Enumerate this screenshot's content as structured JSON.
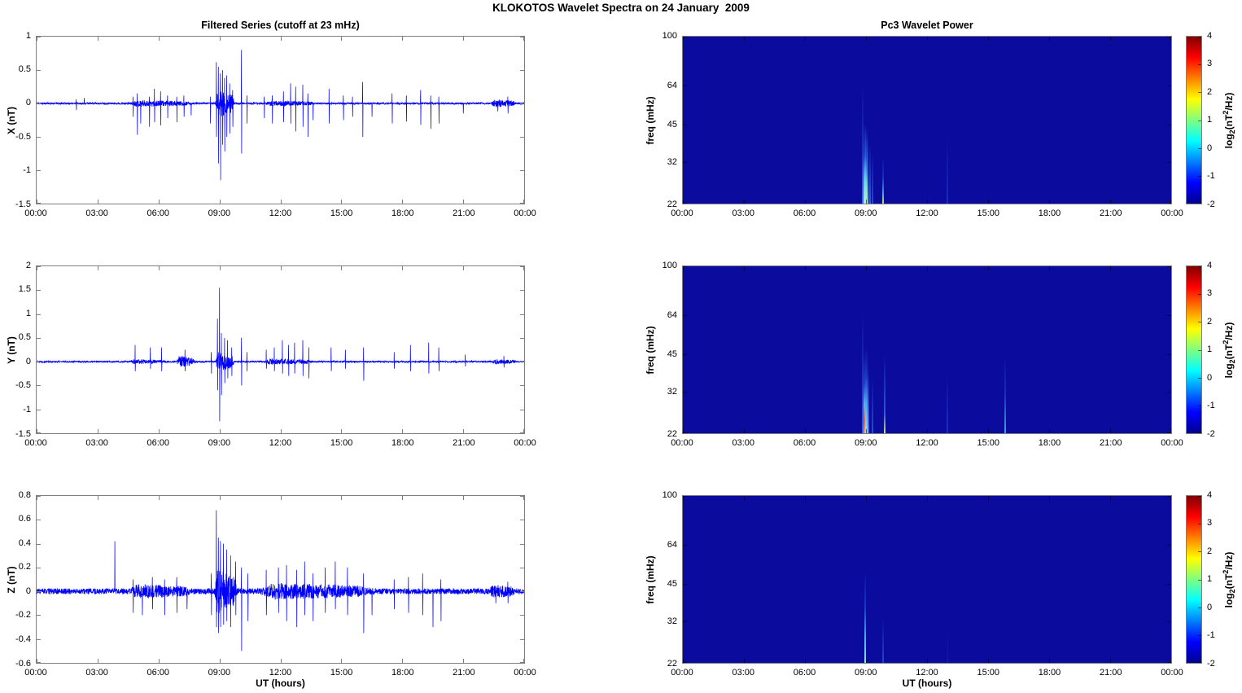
{
  "figure_title": "KLOKOTOS Wavelet Spectra on 24 January  2009",
  "left_column": {
    "title": "Filtered Series (cutoff at 23 mHz)",
    "xlabel": "UT (hours)"
  },
  "right_column": {
    "title": "Pc3 Wavelet Power",
    "xlabel": "UT (hours)"
  },
  "time_axis": {
    "tick_labels": [
      "00:00",
      "03:00",
      "06:00",
      "09:00",
      "12:00",
      "15:00",
      "18:00",
      "21:00",
      "00:00"
    ],
    "tick_hours": [
      0,
      3,
      6,
      9,
      12,
      15,
      18,
      21,
      24
    ],
    "range_hours": [
      0,
      24
    ]
  },
  "colorbar": {
    "ticks": [
      4,
      3,
      2,
      1,
      0,
      -1,
      -2
    ],
    "range": [
      -2,
      4
    ],
    "label_parts": {
      "base": "log",
      "sub": "2",
      "mid": "(nT",
      "sup": "2",
      "end": "/Hz)"
    },
    "jet_stops": [
      [
        "#000090",
        0
      ],
      [
        "#0000ff",
        12.5
      ],
      [
        "#00ffff",
        37.5
      ],
      [
        "#ffff00",
        62.5
      ],
      [
        "#ff0000",
        87.5
      ],
      [
        "#800000",
        100
      ]
    ]
  },
  "colors": {
    "line": "#0000ff",
    "heat_background": "#0b0b9d",
    "axis_frame": "#7f7f7f"
  },
  "chart_data": [
    {
      "type": "line",
      "ylabel": "X (nT)",
      "ylim": [
        -1.5,
        1
      ],
      "yticks": [
        1,
        0.5,
        0,
        -0.5,
        -1,
        -1.5
      ],
      "seed": 11,
      "noise_base": 0.014,
      "bursts": [
        [
          8.8,
          9.75,
          0.22
        ],
        [
          4.6,
          7.6,
          0.04
        ],
        [
          11.3,
          13.7,
          0.03
        ],
        [
          22.4,
          23.6,
          0.055
        ]
      ],
      "spikes": [
        [
          1.95,
          0.06,
          -0.1
        ],
        [
          2.35,
          0.08,
          null
        ],
        [
          4.75,
          0.1,
          -0.2
        ],
        [
          4.95,
          0.15,
          -0.47
        ],
        [
          5.12,
          null,
          -0.3
        ],
        [
          5.55,
          0.1,
          -0.35
        ],
        [
          5.8,
          0.22,
          -0.28
        ],
        [
          6.1,
          0.18,
          -0.33
        ],
        [
          6.45,
          0.12,
          -0.22
        ],
        [
          6.9,
          0.1,
          -0.28
        ],
        [
          7.25,
          0.12,
          -0.2
        ],
        [
          7.6,
          null,
          -0.18
        ],
        [
          8.55,
          0.1,
          -0.3
        ],
        [
          8.85,
          0.62,
          -0.5
        ],
        [
          8.95,
          0.55,
          -0.9
        ],
        [
          9.05,
          0.45,
          -1.15
        ],
        [
          9.15,
          0.5,
          -0.62
        ],
        [
          9.25,
          0.38,
          -0.72
        ],
        [
          9.35,
          0.42,
          -0.5
        ],
        [
          9.5,
          0.3,
          -0.45
        ],
        [
          9.65,
          0.2,
          -0.35
        ],
        [
          10.08,
          0.8,
          -0.75
        ],
        [
          10.35,
          0.12,
          -0.3
        ],
        [
          11.2,
          0.1,
          -0.22
        ],
        [
          11.6,
          0.12,
          -0.3
        ],
        [
          12.15,
          0.18,
          -0.28
        ],
        [
          12.5,
          0.3,
          -0.3
        ],
        [
          12.75,
          0.25,
          -0.42
        ],
        [
          13.1,
          0.28,
          -0.35
        ],
        [
          13.35,
          0.15,
          -0.5
        ],
        [
          13.6,
          null,
          -0.25
        ],
        [
          14.4,
          0.22,
          -0.3
        ],
        [
          15.1,
          0.12,
          -0.25
        ],
        [
          15.55,
          0.1,
          -0.2
        ],
        [
          16.05,
          0.32,
          -0.5
        ],
        [
          16.5,
          null,
          -0.2
        ],
        [
          17.5,
          0.15,
          -0.3
        ],
        [
          18.2,
          0.12,
          -0.27
        ],
        [
          18.9,
          0.2,
          -0.32
        ],
        [
          19.4,
          0.12,
          -0.38
        ],
        [
          19.8,
          0.1,
          -0.3
        ],
        [
          21.0,
          null,
          -0.15
        ],
        [
          22.7,
          null,
          -0.12
        ],
        [
          23.2,
          0.1,
          -0.15
        ]
      ]
    },
    {
      "type": "heatmap",
      "ylabel": "freq (mHz)",
      "flim": [
        22,
        100
      ],
      "yticks": [
        100,
        64,
        45,
        32,
        22
      ],
      "streaks": [
        {
          "t": 8.83,
          "f_top": 64,
          "w": 2,
          "stops": [
            [
              "rgba(60,120,235,0.9)",
              0
            ],
            [
              "rgba(40,80,210,0.6)",
              40
            ],
            [
              "rgba(11,11,157,0)",
              100
            ]
          ]
        },
        {
          "t": 8.93,
          "f_top": 46,
          "w": 3,
          "stops": [
            [
              "#aef0e8",
              0
            ],
            [
              "#55d0f5",
              30
            ],
            [
              "rgba(30,90,220,0.7)",
              60
            ],
            [
              "rgba(11,11,157,0)",
              100
            ]
          ]
        },
        {
          "t": 9.0,
          "f_top": 44,
          "w": 3,
          "stops": [
            [
              "#d8ee8a",
              0
            ],
            [
              "#7fe0d8",
              25
            ],
            [
              "rgba(40,110,230,0.7)",
              60
            ],
            [
              "rgba(11,11,157,0)",
              100
            ]
          ]
        },
        {
          "t": 9.08,
          "f_top": 40,
          "w": 2,
          "stops": [
            [
              "#66d4f0",
              0
            ],
            [
              "rgba(40,100,225,0.7)",
              50
            ],
            [
              "rgba(11,11,157,0)",
              100
            ]
          ]
        },
        {
          "t": 9.2,
          "f_top": 38,
          "w": 2,
          "stops": [
            [
              "rgba(50,110,230,0.85)",
              0
            ],
            [
              "rgba(11,11,157,0)",
              100
            ]
          ]
        },
        {
          "t": 9.33,
          "f_top": 35,
          "w": 2,
          "stops": [
            [
              "rgba(40,90,220,0.8)",
              0
            ],
            [
              "rgba(11,11,157,0)",
              100
            ]
          ]
        },
        {
          "t": 9.85,
          "f_top": 34,
          "w": 2,
          "stops": [
            [
              "#c8e26a",
              0
            ],
            [
              "#3f9ae8",
              22
            ],
            [
              "rgba(25,60,200,0.7)",
              55
            ],
            [
              "rgba(11,11,157,0)",
              100
            ]
          ]
        },
        {
          "t": 13.0,
          "f_top": 40,
          "w": 2,
          "stops": [
            [
              "rgba(30,60,200,0.7)",
              0
            ],
            [
              "rgba(11,11,157,0)",
              100
            ]
          ]
        }
      ]
    },
    {
      "type": "line",
      "ylabel": "Y (nT)",
      "ylim": [
        -1.5,
        2
      ],
      "yticks": [
        2,
        1.5,
        1,
        0.5,
        0,
        -0.5,
        -1,
        -1.5
      ],
      "seed": 22,
      "noise_base": 0.016,
      "bursts": [
        [
          8.8,
          9.75,
          0.2
        ],
        [
          6.9,
          7.8,
          0.12
        ],
        [
          4.6,
          6.4,
          0.04
        ],
        [
          11.2,
          13.6,
          0.05
        ],
        [
          22.4,
          23.6,
          0.04
        ]
      ],
      "spikes": [
        [
          4.85,
          0.35,
          -0.2
        ],
        [
          5.6,
          0.3,
          -0.15
        ],
        [
          6.15,
          0.3,
          -0.2
        ],
        [
          7.3,
          0.25,
          -0.2
        ],
        [
          8.6,
          0.2,
          -0.25
        ],
        [
          8.9,
          0.9,
          -0.6
        ],
        [
          9.0,
          1.55,
          -1.25
        ],
        [
          9.1,
          0.6,
          -0.7
        ],
        [
          9.25,
          0.5,
          -0.45
        ],
        [
          9.4,
          0.45,
          -0.35
        ],
        [
          9.6,
          0.3,
          -0.3
        ],
        [
          10.08,
          0.5,
          -0.5
        ],
        [
          10.35,
          0.2,
          -0.2
        ],
        [
          11.3,
          0.25,
          -0.15
        ],
        [
          11.7,
          0.3,
          -0.2
        ],
        [
          12.1,
          0.45,
          -0.25
        ],
        [
          12.4,
          0.35,
          -0.3
        ],
        [
          12.7,
          0.4,
          -0.25
        ],
        [
          13.1,
          0.45,
          -0.3
        ],
        [
          13.4,
          0.3,
          -0.35
        ],
        [
          14.5,
          0.3,
          -0.2
        ],
        [
          15.2,
          0.25,
          -0.15
        ],
        [
          16.1,
          0.3,
          -0.4
        ],
        [
          17.6,
          0.2,
          -0.15
        ],
        [
          18.4,
          0.35,
          -0.2
        ],
        [
          19.3,
          0.4,
          -0.25
        ],
        [
          19.8,
          0.3,
          -0.2
        ],
        [
          21.1,
          0.15,
          -0.1
        ],
        [
          23.0,
          0.12,
          -0.12
        ]
      ]
    },
    {
      "type": "heatmap",
      "ylabel": "freq (mHz)",
      "flim": [
        22,
        100
      ],
      "yticks": [
        100,
        64,
        45,
        32,
        22
      ],
      "streaks": [
        {
          "t": 8.83,
          "f_top": 66,
          "w": 2,
          "stops": [
            [
              "rgba(60,110,230,0.9)",
              0
            ],
            [
              "rgba(40,80,210,0.55)",
              45
            ],
            [
              "rgba(11,11,157,0)",
              100
            ]
          ]
        },
        {
          "t": 8.92,
          "f_top": 46,
          "w": 2,
          "stops": [
            [
              "#e8a060",
              0
            ],
            [
              "#e86040",
              15
            ],
            [
              "#58b8e8",
              35
            ],
            [
              "rgba(40,90,220,0.7)",
              60
            ],
            [
              "rgba(11,11,157,0)",
              100
            ]
          ]
        },
        {
          "t": 9.02,
          "f_top": 48,
          "w": 3,
          "stops": [
            [
              "#90e0f8",
              0
            ],
            [
              "#48a8f0",
              35
            ],
            [
              "rgba(30,80,215,0.7)",
              65
            ],
            [
              "rgba(11,11,157,0)",
              100
            ]
          ]
        },
        {
          "t": 9.12,
          "f_top": 40,
          "w": 2,
          "stops": [
            [
              "rgba(70,140,240,0.9)",
              0
            ],
            [
              "rgba(11,11,157,0)",
              100
            ]
          ]
        },
        {
          "t": 9.3,
          "f_top": 36,
          "w": 2,
          "stops": [
            [
              "rgba(45,95,220,0.8)",
              0
            ],
            [
              "rgba(11,11,157,0)",
              100
            ]
          ]
        },
        {
          "t": 9.9,
          "f_top": 45,
          "w": 2,
          "stops": [
            [
              "#cde070",
              0
            ],
            [
              "rgba(50,110,230,0.8)",
              25
            ],
            [
              "rgba(11,11,157,0)",
              100
            ]
          ]
        },
        {
          "t": 13.0,
          "f_top": 38,
          "w": 2,
          "stops": [
            [
              "rgba(35,65,205,0.7)",
              0
            ],
            [
              "rgba(11,11,157,0)",
              100
            ]
          ]
        },
        {
          "t": 15.83,
          "f_top": 45,
          "w": 2,
          "stops": [
            [
              "rgba(80,200,240,0.8)",
              0
            ],
            [
              "rgba(40,80,210,0.5)",
              50
            ],
            [
              "rgba(11,11,157,0)",
              100
            ]
          ]
        }
      ]
    },
    {
      "type": "line",
      "ylabel": "Z (nT)",
      "ylim": [
        -0.6,
        0.8
      ],
      "yticks": [
        0.8,
        0.6,
        0.4,
        0.2,
        0,
        -0.2,
        -0.4,
        -0.6
      ],
      "seed": 33,
      "noise_base": 0.024,
      "bursts": [
        [
          8.75,
          9.9,
          0.18
        ],
        [
          11.0,
          16.5,
          0.05
        ],
        [
          4.6,
          7.6,
          0.04
        ],
        [
          22.3,
          23.6,
          0.035
        ]
      ],
      "spikes": [
        [
          3.85,
          0.42,
          null
        ],
        [
          4.75,
          0.1,
          -0.18
        ],
        [
          5.2,
          null,
          -0.2
        ],
        [
          5.7,
          0.12,
          -0.15
        ],
        [
          6.3,
          0.1,
          -0.2
        ],
        [
          6.9,
          0.12,
          -0.18
        ],
        [
          7.4,
          null,
          -0.15
        ],
        [
          8.6,
          0.15,
          -0.2
        ],
        [
          8.85,
          0.68,
          -0.3
        ],
        [
          8.95,
          0.45,
          -0.35
        ],
        [
          9.05,
          0.42,
          -0.3
        ],
        [
          9.2,
          0.4,
          -0.28
        ],
        [
          9.35,
          0.35,
          -0.25
        ],
        [
          9.55,
          0.3,
          -0.3
        ],
        [
          9.8,
          0.25,
          -0.2
        ],
        [
          10.08,
          0.2,
          -0.5
        ],
        [
          10.4,
          0.15,
          -0.25
        ],
        [
          11.3,
          0.18,
          -0.2
        ],
        [
          11.9,
          0.2,
          -0.18
        ],
        [
          12.3,
          0.22,
          -0.25
        ],
        [
          12.8,
          0.18,
          -0.3
        ],
        [
          13.2,
          0.25,
          -0.2
        ],
        [
          13.6,
          0.15,
          -0.25
        ],
        [
          14.2,
          0.2,
          -0.18
        ],
        [
          14.7,
          0.25,
          -0.15
        ],
        [
          15.3,
          0.2,
          -0.2
        ],
        [
          16.1,
          0.15,
          -0.35
        ],
        [
          16.5,
          null,
          -0.2
        ],
        [
          17.6,
          0.1,
          -0.15
        ],
        [
          18.3,
          0.12,
          -0.18
        ],
        [
          19.0,
          0.15,
          -0.2
        ],
        [
          19.5,
          null,
          -0.3
        ],
        [
          19.9,
          0.1,
          -0.25
        ],
        [
          22.6,
          null,
          -0.1
        ],
        [
          23.2,
          0.08,
          -0.1
        ]
      ]
    },
    {
      "type": "heatmap",
      "ylabel": "freq (mHz)",
      "flim": [
        22,
        100
      ],
      "yticks": [
        100,
        64,
        45,
        32,
        22
      ],
      "streaks": [
        {
          "t": 8.95,
          "f_top": 50,
          "w": 2,
          "stops": [
            [
              "#8ae4f8",
              0
            ],
            [
              "#44a8f0",
              30
            ],
            [
              "rgba(30,80,215,0.7)",
              60
            ],
            [
              "rgba(11,11,157,0)",
              100
            ]
          ]
        },
        {
          "t": 9.85,
          "f_top": 33,
          "w": 2,
          "stops": [
            [
              "rgba(40,90,220,0.75)",
              0
            ],
            [
              "rgba(11,11,157,0)",
              100
            ]
          ]
        },
        {
          "t": 13.0,
          "f_top": 30,
          "w": 1,
          "stops": [
            [
              "rgba(30,55,195,0.5)",
              0
            ],
            [
              "rgba(11,11,157,0)",
              100
            ]
          ]
        }
      ]
    }
  ]
}
